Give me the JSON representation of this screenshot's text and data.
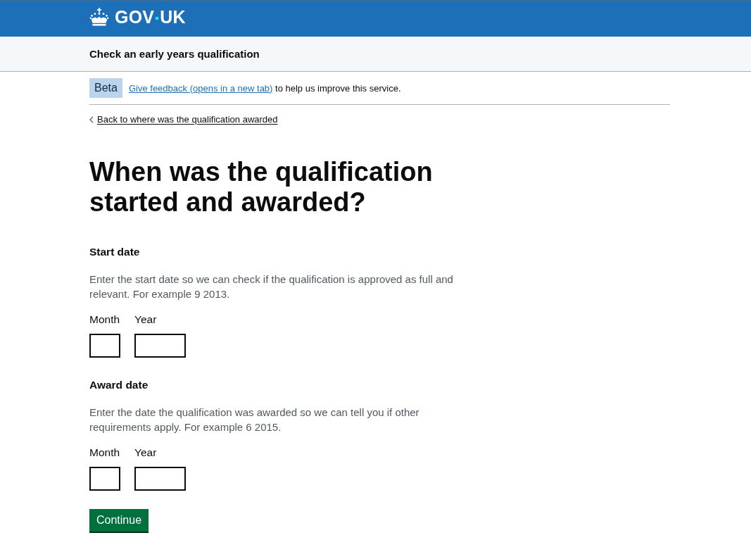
{
  "header": {
    "logo_words": [
      "GOV",
      "UK"
    ]
  },
  "service_navigation": {
    "service_name": "Check an early years qualification"
  },
  "phase_banner": {
    "tag": "Beta",
    "link": "Give feedback (opens in a new tab)",
    "text": "to help us improve this service."
  },
  "back_link": "Back to where was the qualification awarded",
  "heading": "When was the qualification started and awarded?",
  "date_groups": [
    {
      "legend": "Start date",
      "hint": "Enter the start date so we can check if the qualification is approved as full and relevant. For example 9 2013.",
      "inputs": [
        {
          "kind": "month",
          "label": "Month"
        },
        {
          "kind": "year",
          "label": "Year"
        }
      ]
    },
    {
      "legend": "Award date",
      "hint": "Enter the date the qualification was awarded so we can tell you if other requirements apply. For example 6 2015.",
      "inputs": [
        {
          "kind": "month",
          "label": "Month"
        },
        {
          "kind": "year",
          "label": "Year"
        }
      ]
    }
  ],
  "button": {
    "label": "Continue"
  }
}
